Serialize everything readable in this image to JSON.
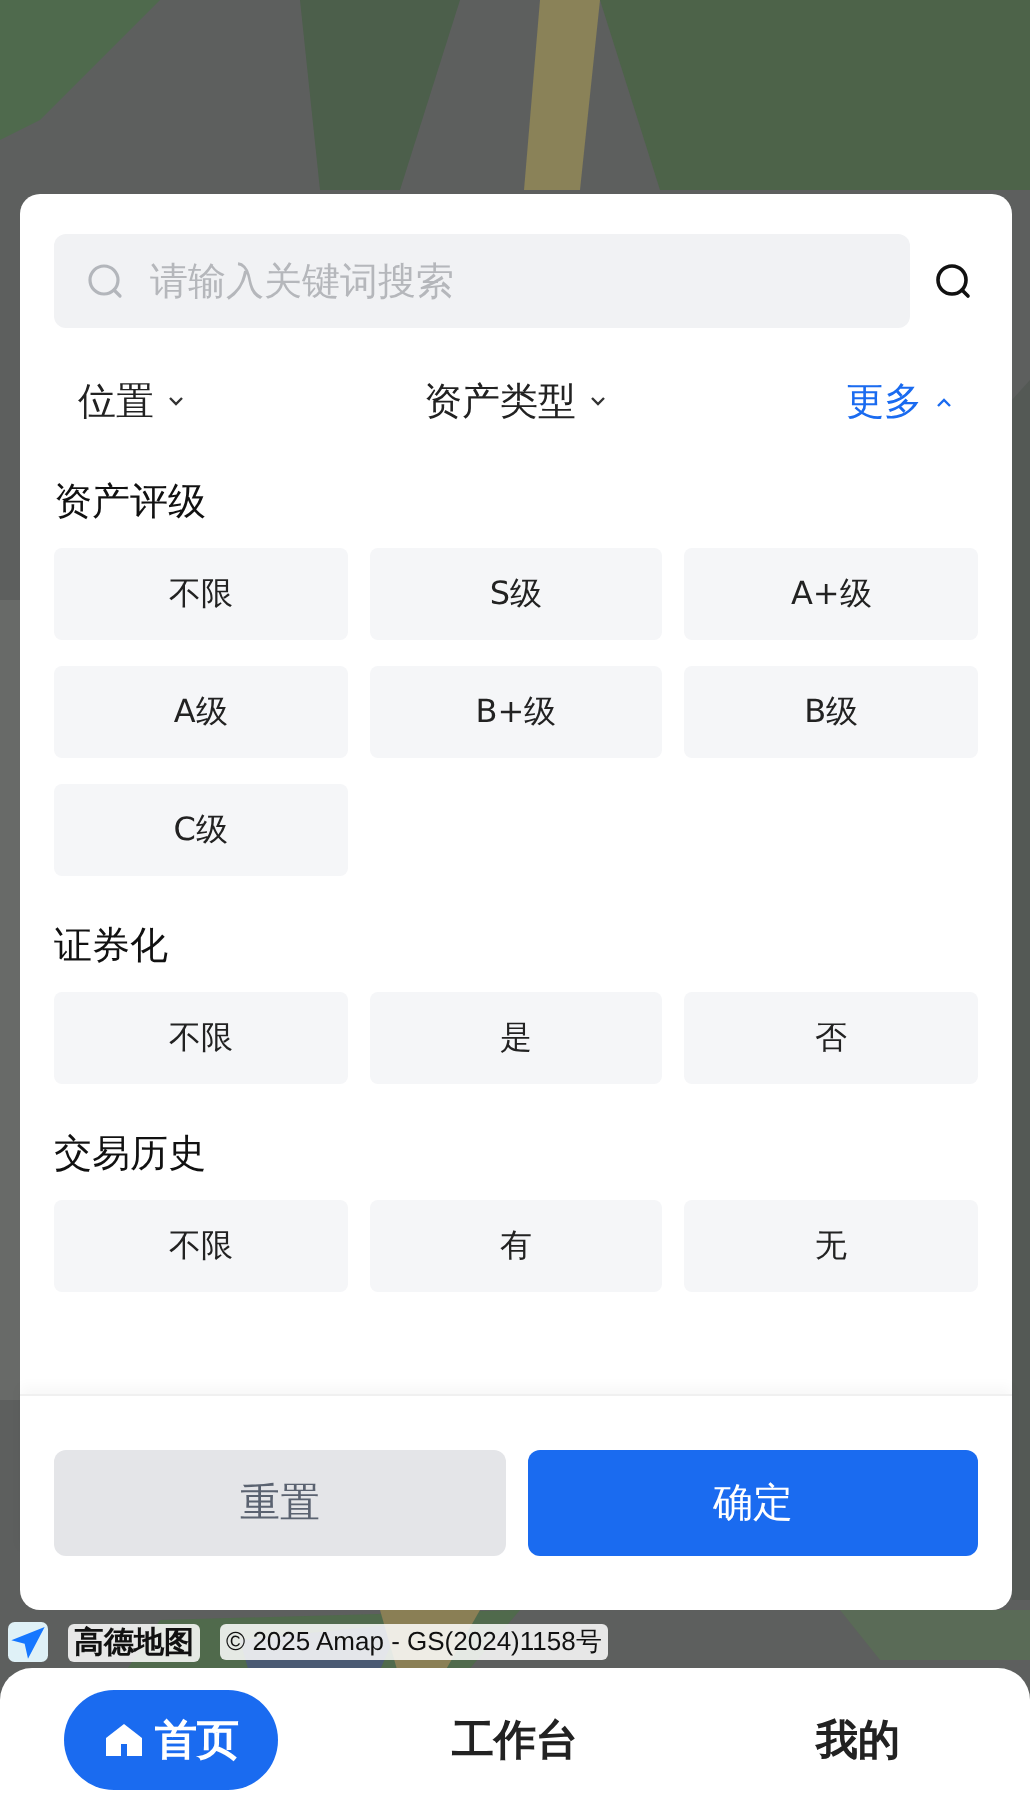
{
  "search": {
    "placeholder": "请输入关键词搜索"
  },
  "filters": [
    {
      "label": "位置",
      "expanded": false
    },
    {
      "label": "资产类型",
      "expanded": false
    },
    {
      "label": "更多",
      "expanded": true
    }
  ],
  "sections": [
    {
      "title": "资产评级",
      "options": [
        {
          "label": "不限",
          "selected": false
        },
        {
          "label": "S级",
          "selected": false
        },
        {
          "label": "A+级",
          "selected": false
        },
        {
          "label": "A级",
          "selected": false
        },
        {
          "label": "B+级",
          "selected": false
        },
        {
          "label": "B级",
          "selected": false
        },
        {
          "label": "C级",
          "selected": false
        }
      ]
    },
    {
      "title": "证券化",
      "options": [
        {
          "label": "不限",
          "selected": false
        },
        {
          "label": "是",
          "selected": false
        },
        {
          "label": "否",
          "selected": false
        }
      ]
    },
    {
      "title": "交易历史",
      "options": [
        {
          "label": "不限",
          "selected": false
        },
        {
          "label": "有",
          "selected": false
        },
        {
          "label": "无",
          "selected": false
        }
      ]
    }
  ],
  "buttons": [
    {
      "label": "重置",
      "kind": "secondary"
    },
    {
      "label": "确定",
      "kind": "primary"
    }
  ],
  "map_attribution": {
    "brand": "高德地图",
    "text": "© 2025 Amap - GS(2024)1158号"
  },
  "tabs": [
    {
      "label": "首页",
      "selected": true
    },
    {
      "label": "工作台",
      "selected": false
    },
    {
      "label": "我的",
      "selected": false
    }
  ]
}
